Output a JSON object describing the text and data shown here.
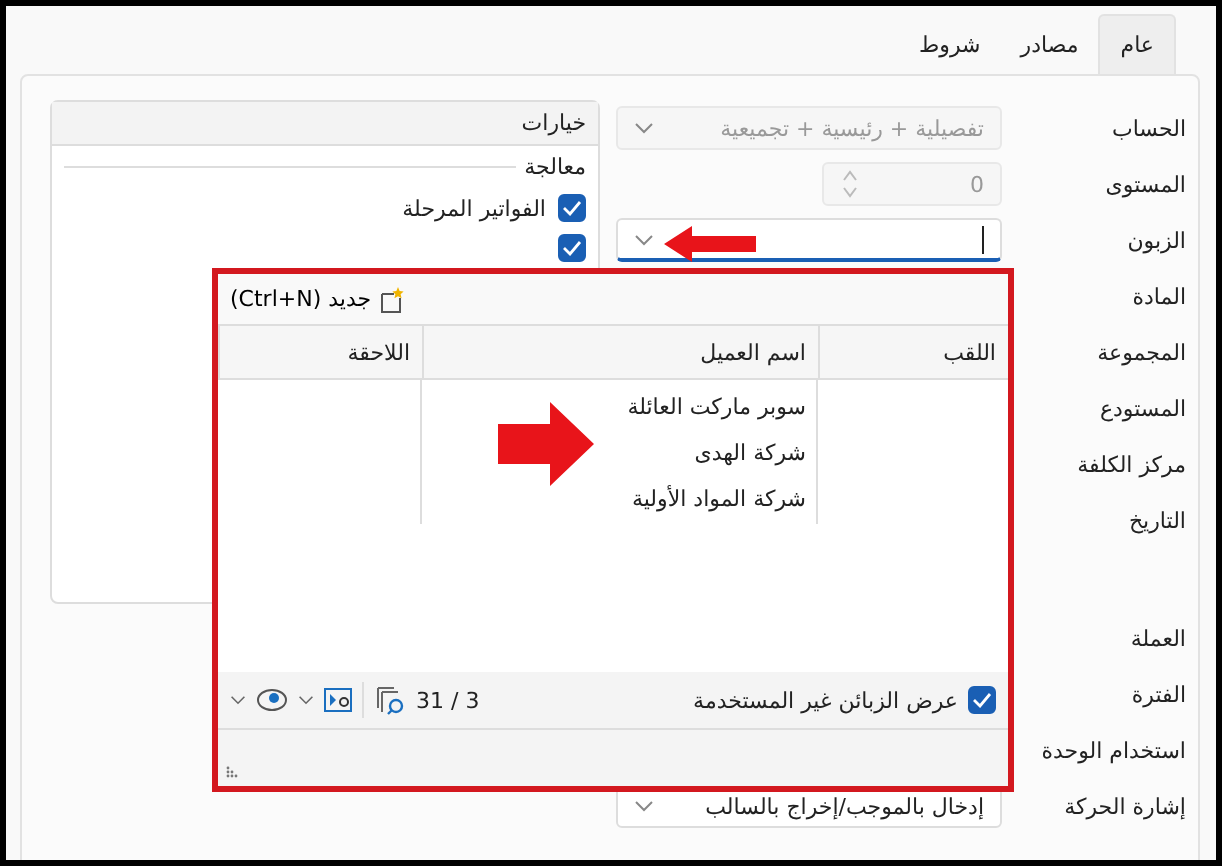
{
  "tabs": [
    {
      "label": "عام",
      "selected": true
    },
    {
      "label": "مصادر",
      "selected": false
    },
    {
      "label": "شروط",
      "selected": false
    }
  ],
  "fields": [
    {
      "label": "الحساب",
      "kind": "dropdown",
      "value": "تفصيلية + رئيسية + تجميعية",
      "disabled": true
    },
    {
      "label": "المستوى",
      "kind": "spinner",
      "value": "0",
      "disabled": true
    },
    {
      "label": "الزبون",
      "kind": "combo"
    },
    {
      "label": "المادة",
      "kind": "covered"
    },
    {
      "label": "المجموعة",
      "kind": "covered"
    },
    {
      "label": "المستودع",
      "kind": "covered"
    },
    {
      "label": "مركز الكلفة",
      "kind": "covered"
    },
    {
      "label": "التاريخ",
      "kind": "covered"
    },
    {
      "label": "العملة",
      "kind": "covered"
    },
    {
      "label": "الفترة",
      "kind": "covered"
    },
    {
      "label": "استخدام الوحدة",
      "kind": "covered"
    },
    {
      "label": "إشارة الحركة",
      "kind": "dropdown",
      "value": "إدخال بالموجب/إخراج بالسالب",
      "disabled": false
    }
  ],
  "options": {
    "title": "خيارات",
    "group": "معالجة",
    "items": [
      {
        "label": "الفواتير المرحلة",
        "checked": true
      },
      {
        "checked": true
      }
    ]
  },
  "popup": {
    "new_button": "جديد (Ctrl+N)",
    "columns": [
      "اللقب",
      "اسم العميل",
      "اللاحقة"
    ],
    "rows": [
      {
        "customer_name": "سوبر ماركت العائلة"
      },
      {
        "customer_name": "شركة الهدى"
      },
      {
        "customer_name": "شركة المواد الأولية"
      }
    ],
    "show_unused": {
      "label": "عرض الزبائن غير المستخدمة",
      "checked": true
    },
    "count": "31 / 3"
  }
}
